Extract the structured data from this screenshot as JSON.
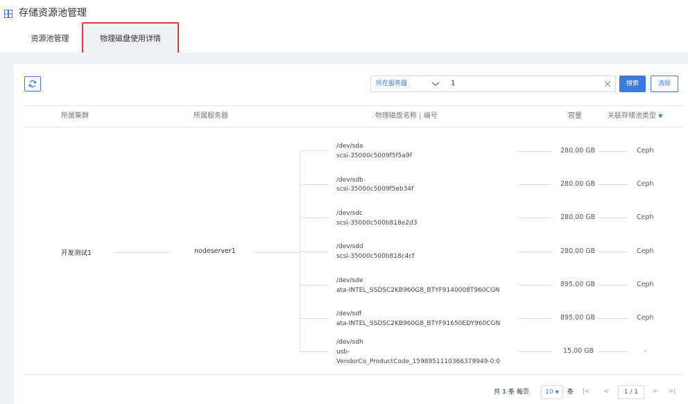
{
  "header": {
    "title": "存储资源池管理",
    "icon": "grid-icon"
  },
  "tabs": [
    {
      "label": "资源池管理"
    },
    {
      "label": "物理磁盘使用详情"
    }
  ],
  "toolbar": {
    "refresh_icon": "refresh-icon",
    "filter_field": "所在服务器",
    "filter_value": "1",
    "search_label": "搜索",
    "clear_label": "清除"
  },
  "table": {
    "columns": [
      "所属集群",
      "所属服务器",
      "物理磁盘名称 | 编号",
      "容量",
      "关联存储池类型"
    ],
    "cluster": "开发测试1",
    "server": "nodeserver1",
    "disks": [
      {
        "name": "/dev/sda",
        "id": "scsi-35000c5009f5f5a9f",
        "capacity": "280.00 GB",
        "pool_type": "Ceph"
      },
      {
        "name": "/dev/sdb",
        "id": "scsi-35000c5009f5eb34f",
        "capacity": "280.00 GB",
        "pool_type": "Ceph"
      },
      {
        "name": "/dev/sdc",
        "id": "scsi-35000c500b818e2d3",
        "capacity": "280.00 GB",
        "pool_type": "Ceph"
      },
      {
        "name": "/dev/sdd",
        "id": "scsi-35000c500b818c4cf",
        "capacity": "280.00 GB",
        "pool_type": "Ceph"
      },
      {
        "name": "/dev/sde",
        "id": "ata-INTEL_SSDSC2KB960G8_BTYF9140008T960CGN",
        "capacity": "895.00 GB",
        "pool_type": "Ceph"
      },
      {
        "name": "/dev/sdf",
        "id": "ata-INTEL_SSDSC2KB960G8_BTYF91650EDY960CGN",
        "capacity": "895.00 GB",
        "pool_type": "Ceph"
      },
      {
        "name": "/dev/sdh",
        "id_line1": "usb-",
        "id_line2": "VendorCo_ProductCode_1598951110366379949-0:0",
        "capacity": "15.00 GB",
        "pool_type": "-"
      }
    ]
  },
  "pagination": {
    "total_prefix": "共",
    "total_count": "1",
    "total_suffix": "条 每页",
    "page_size": "10",
    "page_size_unit": "条",
    "page_indicator": "1 / 1"
  },
  "colors": {
    "accent": "#3b7ae0",
    "highlight": "#e0393b"
  }
}
